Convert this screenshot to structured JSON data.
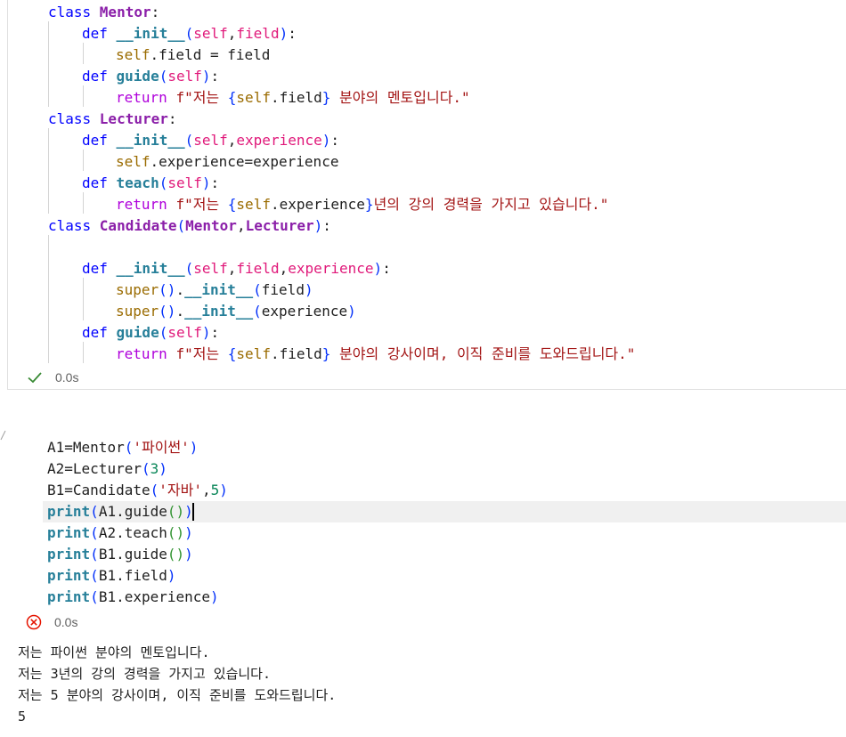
{
  "cell1": {
    "lines": [
      {
        "indent": 0,
        "tokens": [
          {
            "t": "class ",
            "c": "kw2"
          },
          {
            "t": "Mentor",
            "c": "cls"
          },
          {
            "t": ":",
            "c": "op"
          }
        ]
      },
      {
        "indent": 1,
        "tokens": [
          {
            "t": "def ",
            "c": "kw2"
          },
          {
            "t": "__init__",
            "c": "fn"
          },
          {
            "t": "(",
            "c": "p1"
          },
          {
            "t": "self",
            "c": "param"
          },
          {
            "t": ",",
            "c": "op"
          },
          {
            "t": "field",
            "c": "param"
          },
          {
            "t": ")",
            "c": "p1"
          },
          {
            "t": ":",
            "c": "op"
          }
        ]
      },
      {
        "indent": 2,
        "tokens": [
          {
            "t": "self",
            "c": "self"
          },
          {
            "t": ".field = field",
            "c": "op"
          }
        ]
      },
      {
        "indent": 1,
        "tokens": [
          {
            "t": "def ",
            "c": "kw2"
          },
          {
            "t": "guide",
            "c": "fn"
          },
          {
            "t": "(",
            "c": "p1"
          },
          {
            "t": "self",
            "c": "param"
          },
          {
            "t": ")",
            "c": "p1"
          },
          {
            "t": ":",
            "c": "op"
          }
        ]
      },
      {
        "indent": 2,
        "tokens": [
          {
            "t": "return ",
            "c": "kwr"
          },
          {
            "t": "f\"저는 ",
            "c": "str"
          },
          {
            "t": "{",
            "c": "brace"
          },
          {
            "t": "self",
            "c": "self"
          },
          {
            "t": ".field",
            "c": "op"
          },
          {
            "t": "}",
            "c": "brace"
          },
          {
            "t": " 분야의 멘토입니다.\"",
            "c": "str"
          }
        ]
      },
      {
        "indent": 0,
        "tokens": [
          {
            "t": "class ",
            "c": "kw2"
          },
          {
            "t": "Lecturer",
            "c": "cls"
          },
          {
            "t": ":",
            "c": "op"
          }
        ]
      },
      {
        "indent": 1,
        "tokens": [
          {
            "t": "def ",
            "c": "kw2"
          },
          {
            "t": "__init__",
            "c": "fn"
          },
          {
            "t": "(",
            "c": "p1"
          },
          {
            "t": "self",
            "c": "param"
          },
          {
            "t": ",",
            "c": "op"
          },
          {
            "t": "experience",
            "c": "param"
          },
          {
            "t": ")",
            "c": "p1"
          },
          {
            "t": ":",
            "c": "op"
          }
        ]
      },
      {
        "indent": 2,
        "tokens": [
          {
            "t": "self",
            "c": "self"
          },
          {
            "t": ".experience=experience",
            "c": "op"
          }
        ]
      },
      {
        "indent": 1,
        "tokens": [
          {
            "t": "def ",
            "c": "kw2"
          },
          {
            "t": "teach",
            "c": "fn"
          },
          {
            "t": "(",
            "c": "p1"
          },
          {
            "t": "self",
            "c": "param"
          },
          {
            "t": ")",
            "c": "p1"
          },
          {
            "t": ":",
            "c": "op"
          }
        ]
      },
      {
        "indent": 2,
        "tokens": [
          {
            "t": "return ",
            "c": "kwr"
          },
          {
            "t": "f\"저는 ",
            "c": "str"
          },
          {
            "t": "{",
            "c": "brace"
          },
          {
            "t": "self",
            "c": "self"
          },
          {
            "t": ".experience",
            "c": "op"
          },
          {
            "t": "}",
            "c": "brace"
          },
          {
            "t": "년의 강의 경력을 가지고 있습니다.\"",
            "c": "str"
          }
        ]
      },
      {
        "indent": 0,
        "tokens": [
          {
            "t": "class ",
            "c": "kw2"
          },
          {
            "t": "Candidate",
            "c": "cls"
          },
          {
            "t": "(",
            "c": "p1"
          },
          {
            "t": "Mentor",
            "c": "cls"
          },
          {
            "t": ",",
            "c": "op"
          },
          {
            "t": "Lecturer",
            "c": "cls"
          },
          {
            "t": ")",
            "c": "p1"
          },
          {
            "t": ":",
            "c": "op"
          }
        ]
      },
      {
        "indent": 0,
        "tokens": []
      },
      {
        "indent": 1,
        "tokens": [
          {
            "t": "def ",
            "c": "kw2"
          },
          {
            "t": "__init__",
            "c": "fn"
          },
          {
            "t": "(",
            "c": "p1"
          },
          {
            "t": "self",
            "c": "param"
          },
          {
            "t": ",",
            "c": "op"
          },
          {
            "t": "field",
            "c": "param"
          },
          {
            "t": ",",
            "c": "op"
          },
          {
            "t": "experience",
            "c": "param"
          },
          {
            "t": ")",
            "c": "p1"
          },
          {
            "t": ":",
            "c": "op"
          }
        ]
      },
      {
        "indent": 2,
        "tokens": [
          {
            "t": "super",
            "c": "self"
          },
          {
            "t": "()",
            "c": "p1"
          },
          {
            "t": ".",
            "c": "op"
          },
          {
            "t": "__init__",
            "c": "fn"
          },
          {
            "t": "(",
            "c": "p1"
          },
          {
            "t": "field",
            "c": "op"
          },
          {
            "t": ")",
            "c": "p1"
          }
        ]
      },
      {
        "indent": 2,
        "tokens": [
          {
            "t": "super",
            "c": "self"
          },
          {
            "t": "()",
            "c": "p1"
          },
          {
            "t": ".",
            "c": "op"
          },
          {
            "t": "__init__",
            "c": "fn"
          },
          {
            "t": "(",
            "c": "p1"
          },
          {
            "t": "experience",
            "c": "op"
          },
          {
            "t": ")",
            "c": "p1"
          }
        ]
      },
      {
        "indent": 1,
        "tokens": [
          {
            "t": "def ",
            "c": "kw2"
          },
          {
            "t": "guide",
            "c": "fn"
          },
          {
            "t": "(",
            "c": "p1"
          },
          {
            "t": "self",
            "c": "param"
          },
          {
            "t": ")",
            "c": "p1"
          },
          {
            "t": ":",
            "c": "op"
          }
        ]
      },
      {
        "indent": 2,
        "tokens": [
          {
            "t": "return ",
            "c": "kwr"
          },
          {
            "t": "f\"저는 ",
            "c": "str"
          },
          {
            "t": "{",
            "c": "brace"
          },
          {
            "t": "self",
            "c": "self"
          },
          {
            "t": ".field",
            "c": "op"
          },
          {
            "t": "}",
            "c": "brace"
          },
          {
            "t": " 분야의 강사이며, 이직 준비를 도와드립니다.\"",
            "c": "str"
          }
        ]
      }
    ],
    "status": {
      "icon": "check-icon",
      "time": "0.0s",
      "color": "#388a34"
    }
  },
  "cell2": {
    "lines": [
      {
        "indent": 0,
        "tokens": [
          {
            "t": "A1",
            "c": "op"
          },
          {
            "t": "=",
            "c": "op"
          },
          {
            "t": "Mentor",
            "c": "op"
          },
          {
            "t": "(",
            "c": "p1"
          },
          {
            "t": "'파이썬'",
            "c": "str"
          },
          {
            "t": ")",
            "c": "p1"
          }
        ]
      },
      {
        "indent": 0,
        "tokens": [
          {
            "t": "A2",
            "c": "op"
          },
          {
            "t": "=",
            "c": "op"
          },
          {
            "t": "Lecturer",
            "c": "op"
          },
          {
            "t": "(",
            "c": "p1"
          },
          {
            "t": "3",
            "c": "num"
          },
          {
            "t": ")",
            "c": "p1"
          }
        ]
      },
      {
        "indent": 0,
        "tokens": [
          {
            "t": "B1",
            "c": "op"
          },
          {
            "t": "=",
            "c": "op"
          },
          {
            "t": "Candidate",
            "c": "op"
          },
          {
            "t": "(",
            "c": "p1"
          },
          {
            "t": "'자바'",
            "c": "str"
          },
          {
            "t": ",",
            "c": "op"
          },
          {
            "t": "5",
            "c": "num"
          },
          {
            "t": ")",
            "c": "p1"
          }
        ]
      },
      {
        "indent": 0,
        "tokens": [
          {
            "t": "print",
            "c": "fn"
          },
          {
            "t": "(",
            "c": "p1"
          },
          {
            "t": "A1.guide",
            "c": "op"
          },
          {
            "t": "()",
            "c": "p2"
          },
          {
            "t": ")",
            "c": "p1"
          }
        ]
      },
      {
        "indent": 0,
        "tokens": [
          {
            "t": "print",
            "c": "fn"
          },
          {
            "t": "(",
            "c": "p1"
          },
          {
            "t": "A2.teach",
            "c": "op"
          },
          {
            "t": "()",
            "c": "p2"
          },
          {
            "t": ")",
            "c": "p1"
          }
        ]
      },
      {
        "indent": 0,
        "tokens": [
          {
            "t": "print",
            "c": "fn"
          },
          {
            "t": "(",
            "c": "p1"
          },
          {
            "t": "B1.guide",
            "c": "op"
          },
          {
            "t": "()",
            "c": "p2"
          },
          {
            "t": ")",
            "c": "p1"
          }
        ]
      },
      {
        "indent": 0,
        "tokens": [
          {
            "t": "print",
            "c": "fn"
          },
          {
            "t": "(",
            "c": "p1"
          },
          {
            "t": "B1.field",
            "c": "op"
          },
          {
            "t": ")",
            "c": "p1"
          }
        ]
      },
      {
        "indent": 0,
        "tokens": [
          {
            "t": "print",
            "c": "fn"
          },
          {
            "t": "(",
            "c": "p1"
          },
          {
            "t": "B1.experience",
            "c": "op"
          },
          {
            "t": ")",
            "c": "p1"
          }
        ]
      }
    ],
    "status": {
      "icon": "error-icon",
      "time": "0.0s",
      "color": "#e51400"
    },
    "output": [
      "저는 파이썬 분야의 멘토입니다.",
      "저는 3년의 강의 경력을 가지고 있습니다.",
      "저는 5 분야의 강사이며, 이직 준비를 도와드립니다.",
      "5"
    ]
  }
}
